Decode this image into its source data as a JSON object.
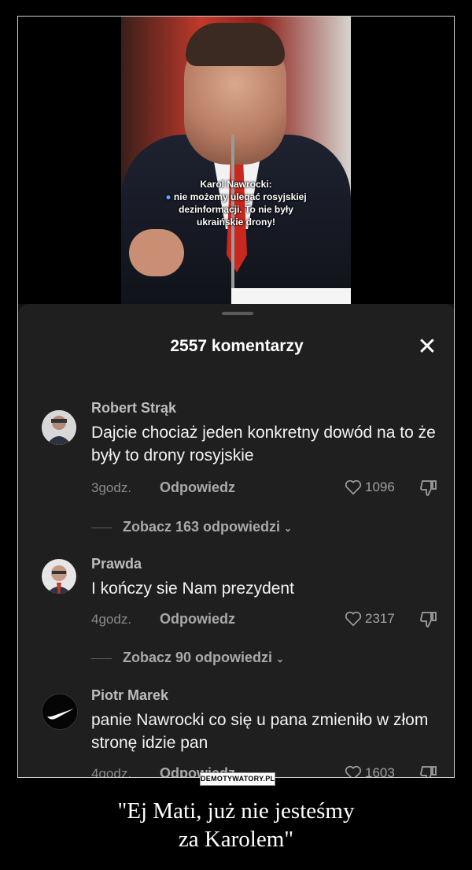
{
  "video": {
    "caption_line1": "Karol Nawrocki:",
    "caption_line2": "nie możemy ulegać rosyjskiej",
    "caption_line3": "dezinformacji. To nie były",
    "caption_line4": "ukraińskie drony!"
  },
  "sheet": {
    "title": "2557 komentarzy",
    "close_icon": "close-icon"
  },
  "comments": [
    {
      "author": "Robert Strąk",
      "text": "Dajcie chociaż jeden konkretny dowód na to że były to drony rosyjskie",
      "time": "3godz.",
      "reply_label": "Odpowiedz",
      "likes": "1096",
      "replies_label": "Zobacz 163 odpowiedzi"
    },
    {
      "author": "Prawda",
      "text": "I kończy sie Nam prezydent",
      "time": "4godz.",
      "reply_label": "Odpowiedz",
      "likes": "2317",
      "replies_label": "Zobacz 90 odpowiedzi"
    },
    {
      "author": "Piotr Marek",
      "text": "panie Nawrocki co się u pana zmieniło w złom stronę idzie pan",
      "time": "4godz.",
      "reply_label": "Odpowiedz",
      "likes": "1603"
    }
  ],
  "watermark": "DEMOTYWATORY.PL",
  "title_line1": "\"Ej Mati, już nie jesteśmy",
  "title_line2": "za Karolem\""
}
